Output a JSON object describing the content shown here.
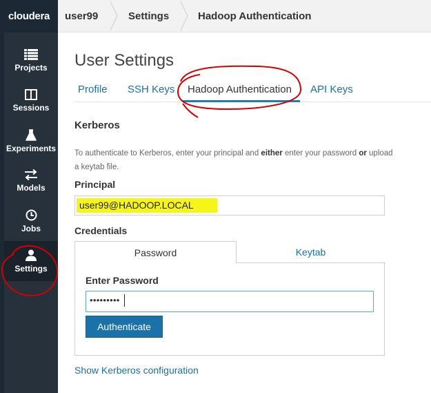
{
  "topbar": {
    "logo": "cloudera",
    "breadcrumbs": [
      "user99",
      "Settings",
      "Hadoop Authentication"
    ]
  },
  "sidebar": {
    "items": [
      {
        "label": "Projects",
        "icon": "projects-icon"
      },
      {
        "label": "Sessions",
        "icon": "sessions-icon"
      },
      {
        "label": "Experiments",
        "icon": "flask-icon"
      },
      {
        "label": "Models",
        "icon": "arrows-icon"
      },
      {
        "label": "Jobs",
        "icon": "clock-icon"
      },
      {
        "label": "Settings",
        "icon": "user-icon",
        "active": true
      }
    ]
  },
  "page": {
    "title": "User Settings",
    "tabs": [
      {
        "label": "Profile"
      },
      {
        "label": "SSH Keys"
      },
      {
        "label": "Hadoop Authentication",
        "active": true
      },
      {
        "label": "API Keys"
      }
    ]
  },
  "kerberos": {
    "section_title": "Kerberos",
    "help_part1": "To authenticate to Kerberos, enter your principal and ",
    "help_bold1": "either",
    "help_part2": " enter your password ",
    "help_bold2": "or",
    "help_part3": " upload a keytab file.",
    "principal_label": "Principal",
    "principal_value": "user99@HADOOP.LOCAL",
    "credentials_label": "Credentials",
    "cred_tabs": [
      {
        "label": "Password",
        "active": true
      },
      {
        "label": "Keytab"
      }
    ],
    "password_label": "Enter Password",
    "password_masked": "•••••••••",
    "authenticate_label": "Authenticate",
    "show_config_link": "Show Kerberos configuration"
  },
  "colors": {
    "sidebar_bg": "#26313c",
    "link": "#1b6fa8",
    "button": "#1b72a8",
    "highlight": "#f6f518",
    "annotation": "#d40000"
  }
}
